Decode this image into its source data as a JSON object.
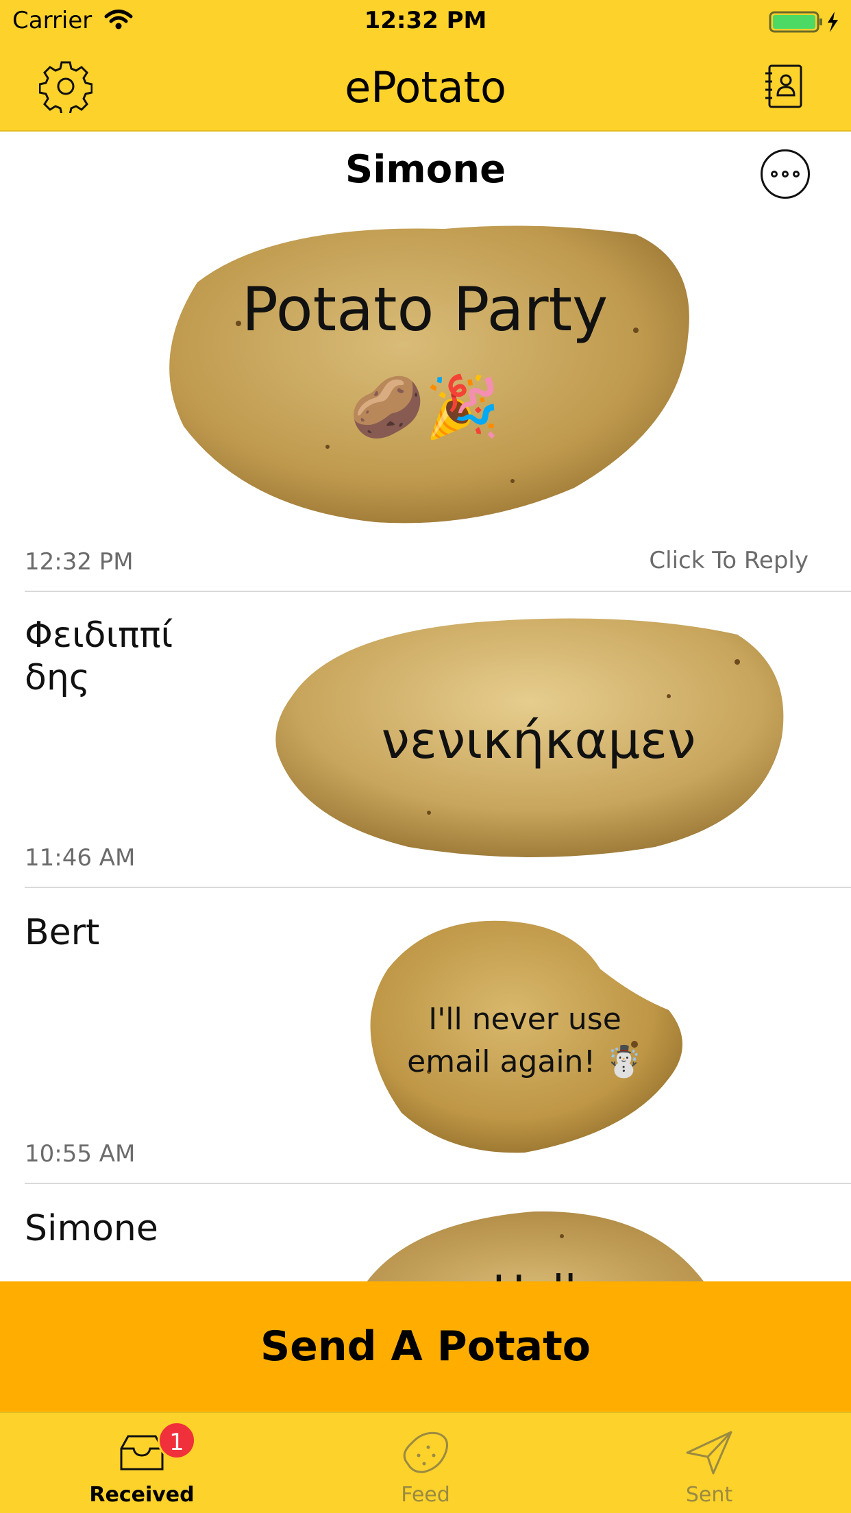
{
  "status_bar": {
    "carrier": "Carrier",
    "time": "12:32 PM"
  },
  "nav": {
    "title": "ePotato",
    "settings_icon": "gear-icon",
    "contacts_icon": "contacts-book-icon"
  },
  "featured": {
    "sender": "Simone",
    "message_line1": "Potato Party",
    "message_emoji": "🥔🎉",
    "time": "12:32 PM",
    "reply_label": "Click To Reply"
  },
  "messages": [
    {
      "sender": "Φειδιππί δης",
      "text": "νενικήκαμεν",
      "time": "11:46 AM"
    },
    {
      "sender": "Bert",
      "text_line1": "I'll never use",
      "text_line2": "email again! ☃️",
      "time": "10:55 AM"
    },
    {
      "sender": "Simone",
      "text": "Hell"
    }
  ],
  "send_button": {
    "label": "Send A Potato"
  },
  "tabs": [
    {
      "label": "Received",
      "badge": "1",
      "icon": "inbox-tray-icon"
    },
    {
      "label": "Feed",
      "icon": "potato-icon"
    },
    {
      "label": "Sent",
      "icon": "paper-plane-icon"
    }
  ],
  "colors": {
    "accent_yellow": "#FDD22A",
    "send_orange": "#FFAE00",
    "badge_red": "#F0303A",
    "potato": "#C9A55A"
  }
}
